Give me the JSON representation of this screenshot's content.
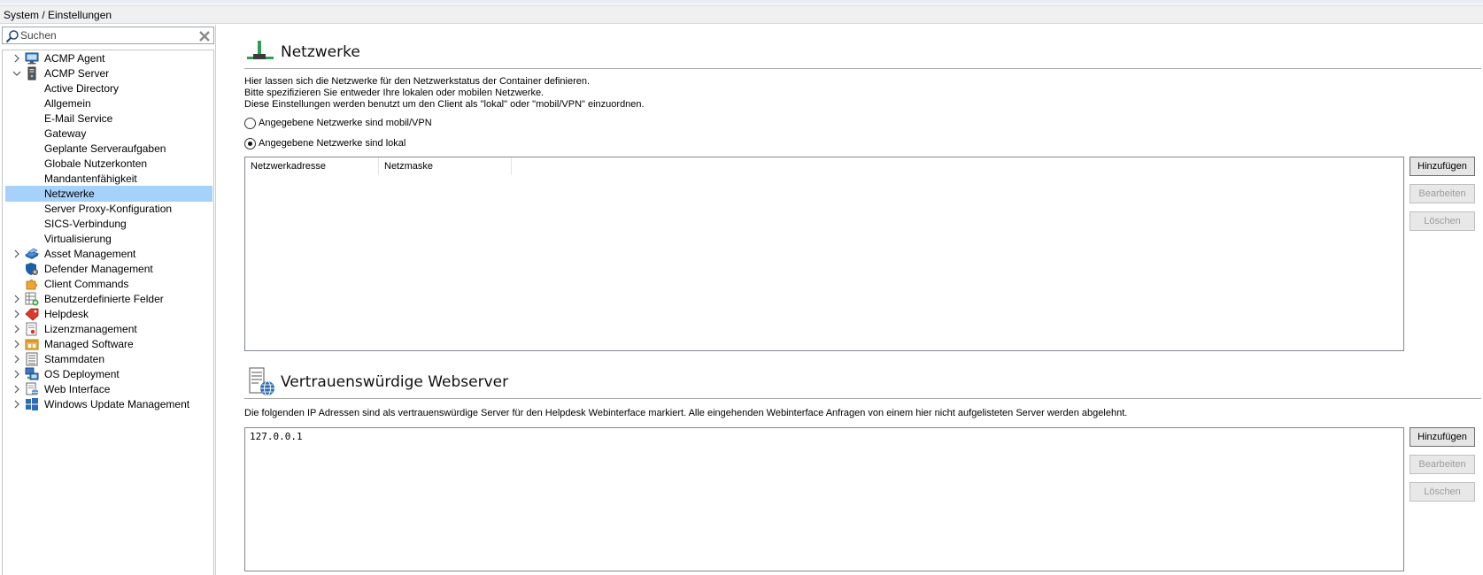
{
  "breadcrumb": "System / Einstellungen",
  "search": {
    "placeholder": "Suchen"
  },
  "tree": [
    {
      "label": "ACMP Agent",
      "icon": "monitor-icon",
      "arrow": "collapsed"
    },
    {
      "label": "ACMP Server",
      "icon": "server-tower-icon",
      "arrow": "expanded"
    },
    {
      "label": "Active Directory",
      "child": true
    },
    {
      "label": "Allgemein",
      "child": true
    },
    {
      "label": "E-Mail Service",
      "child": true
    },
    {
      "label": "Gateway",
      "child": true
    },
    {
      "label": "Geplante Serveraufgaben",
      "child": true
    },
    {
      "label": "Globale Nutzerkonten",
      "child": true
    },
    {
      "label": "Mandantenfähigkeit",
      "child": true
    },
    {
      "label": "Netzwerke",
      "child": true,
      "selected": true
    },
    {
      "label": "Server Proxy-Konfiguration",
      "child": true
    },
    {
      "label": "SICS-Verbindung",
      "child": true
    },
    {
      "label": "Virtualisierung",
      "child": true
    },
    {
      "label": "Asset Management",
      "icon": "asset-management-icon",
      "arrow": "collapsed"
    },
    {
      "label": "Defender Management",
      "icon": "shield-gear-icon"
    },
    {
      "label": "Client Commands",
      "icon": "puzzle-icon"
    },
    {
      "label": "Benutzerdefinierte Felder",
      "icon": "custom-fields-icon",
      "arrow": "collapsed"
    },
    {
      "label": "Helpdesk",
      "icon": "helpdesk-tag-icon",
      "arrow": "collapsed"
    },
    {
      "label": "Lizenzmanagement",
      "icon": "license-icon",
      "arrow": "collapsed"
    },
    {
      "label": "Managed Software",
      "icon": "managed-software-icon",
      "arrow": "collapsed"
    },
    {
      "label": "Stammdaten",
      "icon": "master-data-icon",
      "arrow": "collapsed"
    },
    {
      "label": "OS Deployment",
      "icon": "os-deployment-icon",
      "arrow": "collapsed"
    },
    {
      "label": "Web Interface",
      "icon": "web-interface-icon",
      "arrow": "collapsed"
    },
    {
      "label": "Windows Update Management",
      "icon": "windows-update-icon",
      "arrow": "collapsed"
    }
  ],
  "networks": {
    "title": "Netzwerke",
    "icon": "network-icon",
    "description": [
      "Hier lassen sich die Netzwerke für den Netzwerkstatus der Container definieren.",
      "Bitte spezifizieren Sie entweder Ihre lokalen oder mobilen Netzwerke.",
      "Diese Einstellungen werden benutzt um den Client als \"lokal\" oder \"mobil/VPN\" einzuordnen."
    ],
    "radio_mobile": "Angegebene Netzwerke sind mobil/VPN",
    "radio_local": "Angegebene Netzwerke sind lokal",
    "selected_radio": "local",
    "columns": [
      "Netzwerkadresse",
      "Netzmaske"
    ],
    "buttons": {
      "add": "Hinzufügen",
      "edit": "Bearbeiten",
      "delete": "Löschen"
    }
  },
  "webservers": {
    "title": "Vertrauenswürdige Webserver",
    "icon": "server-globe-icon",
    "description": "Die folgenden IP Adressen sind als vertrauenswürdige Server für den Helpdesk Webinterface markiert. Alle eingehenden Webinterface Anfragen von einem hier nicht aufgelisteten Server werden abgelehnt.",
    "items": [
      "127.0.0.1"
    ],
    "buttons": {
      "add": "Hinzufügen",
      "edit": "Bearbeiten",
      "delete": "Löschen"
    }
  }
}
